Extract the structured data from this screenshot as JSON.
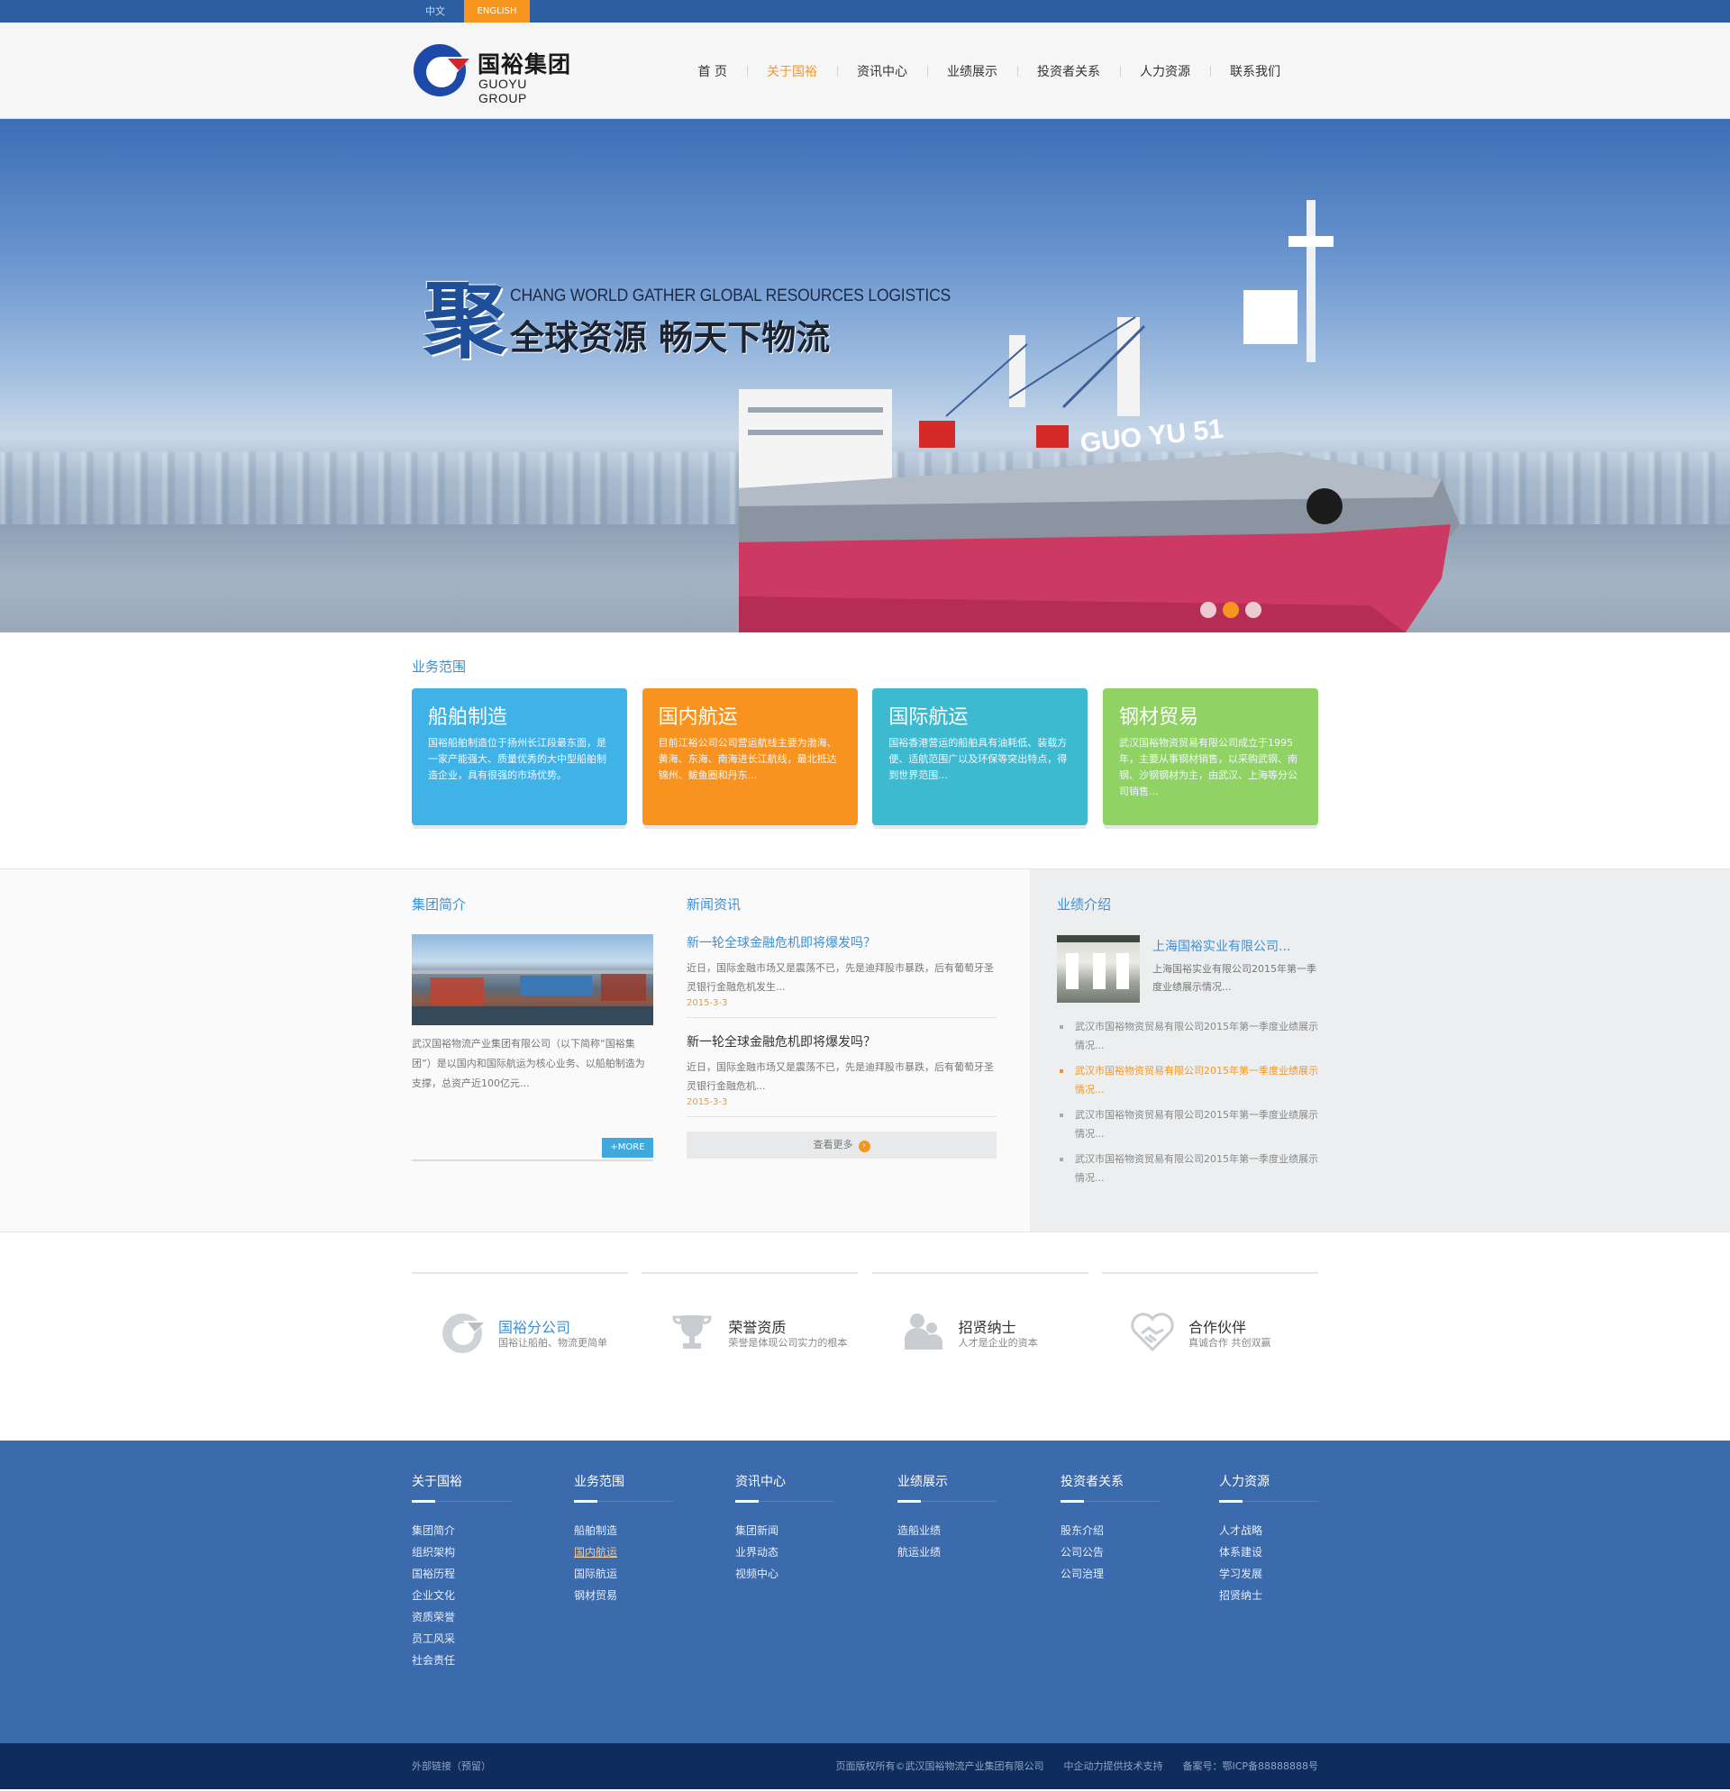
{
  "lang": {
    "zh": "中文",
    "en": "ENGLISH"
  },
  "brand": {
    "name_cn": "国裕集团",
    "name_en": "GUOYU GROUP",
    "colors": {
      "primary": "#2c5ea1",
      "accent": "#f7961e"
    }
  },
  "nav": [
    "首  页",
    "关于国裕",
    "资讯中心",
    "业绩展示",
    "投资者关系",
    "人力资源",
    "联系我们"
  ],
  "nav_active": "关于国裕",
  "banner": {
    "big_char": "聚",
    "slogan_en": "CHANG WORLD GATHER GLOBAL RESOURCES LOGISTICS",
    "slogan_cn": "全球资源  畅天下物流",
    "ship_name": "GUO YU 51",
    "slide_count": 3,
    "active_slide": 2
  },
  "scope": {
    "title": "业务范围",
    "cards": [
      {
        "title": "船舶制造",
        "desc": "国裕船舶制造位于扬州长江段最东面，是一家产能强大、质量优秀的大中型船舶制造企业，具有很强的市场优势。",
        "color": "#3fb3e8"
      },
      {
        "title": "国内航运",
        "desc": "目前江裕公司公司营运航线主要为渤海、黄海、东海、南海进长江航线，最北抵达锦州、鲅鱼圈和丹东...",
        "color": "#f7931e"
      },
      {
        "title": "国际航运",
        "desc": "国裕香港营运的船舶具有油耗低、装载方便、适航范围广以及环保等突出特点，得到世界范围...",
        "color": "#3dbacf"
      },
      {
        "title": "钢材贸易",
        "desc": "武汉国裕物资贸易有限公司成立于1995年，主要从事钢材销售，以采购武钢、南钢、沙钢钢材为主，由武汉、上海等分公司销售...",
        "color": "#90d364"
      }
    ]
  },
  "intro": {
    "title": "集团简介",
    "text": "武汉国裕物流产业集团有限公司（以下简称“国裕集团”）是以国内和国际航运为核心业务、以船舶制造为支撑，总资产近100亿元...",
    "more": "+MORE"
  },
  "news": {
    "title": "新闻资讯",
    "items": [
      {
        "title": "新一轮全球金融危机即将爆发吗？",
        "summary": "近日，国际金融市场又是震荡不已，先是迪拜股市暴跌，后有葡萄牙圣灵银行金融危机发生...",
        "date": "2015-3-3"
      },
      {
        "title": "新一轮全球金融危机即将爆发吗？",
        "summary": "近日，国际金融市场又是震荡不已，先是迪拜股市暴跌，后有葡萄牙圣灵银行金融危机...",
        "date": "2015-3-3"
      }
    ],
    "view_more": "查看更多"
  },
  "performance": {
    "title": "业绩介绍",
    "featured": {
      "title": "上海国裕实业有限公司...",
      "summary": "上海国裕实业有限公司2015年第一季度业绩展示情况..."
    },
    "list": [
      "武汉市国裕物资贸易有限公司2015年第一季度业绩展示情况...",
      "武汉市国裕物资贸易有限公司2015年第一季度业绩展示情况...",
      "武汉市国裕物资贸易有限公司2015年第一季度业绩展示情况...",
      "武汉市国裕物资贸易有限公司2015年第一季度业绩展示情况..."
    ]
  },
  "features": [
    {
      "title": "国裕分公司",
      "desc": "国裕让船舶、物流更简单",
      "icon": "logo-icon"
    },
    {
      "title": "荣誉资质",
      "desc": "荣誉是体现公司实力的根本",
      "icon": "trophy-icon"
    },
    {
      "title": "招贤纳士",
      "desc": "人才是企业的资本",
      "icon": "people-icon"
    },
    {
      "title": "合作伙伴",
      "desc": "真诚合作 共创双赢",
      "icon": "handshake-heart-icon"
    }
  ],
  "footer": {
    "columns": [
      {
        "title": "关于国裕",
        "links": [
          "集团简介",
          "组织架构",
          "国裕历程",
          "企业文化",
          "资质荣誉",
          "员工风采",
          "社会责任"
        ]
      },
      {
        "title": "业务范围",
        "links": [
          "船舶制造",
          "国内航运",
          "国际航运",
          "钢材贸易"
        ]
      },
      {
        "title": "资讯中心",
        "links": [
          "集团新闻",
          "业界动态",
          "视频中心"
        ]
      },
      {
        "title": "业绩展示",
        "links": [
          "造船业绩",
          "航运业绩"
        ]
      },
      {
        "title": "投资者关系",
        "links": [
          "股东介绍",
          "公司公告",
          "公司治理"
        ]
      },
      {
        "title": "人力资源",
        "links": [
          "人才战略",
          "体系建设",
          "学习发展",
          "招贤纳士"
        ]
      }
    ],
    "current_link": "国内航运"
  },
  "copyright": {
    "links_label": "外部链接（预留）",
    "rights": "页面版权所有©武汉国裕物流产业集团有限公司",
    "support": "中企动力提供技术支持",
    "icp": "备案号：鄂ICP备88888888号"
  }
}
